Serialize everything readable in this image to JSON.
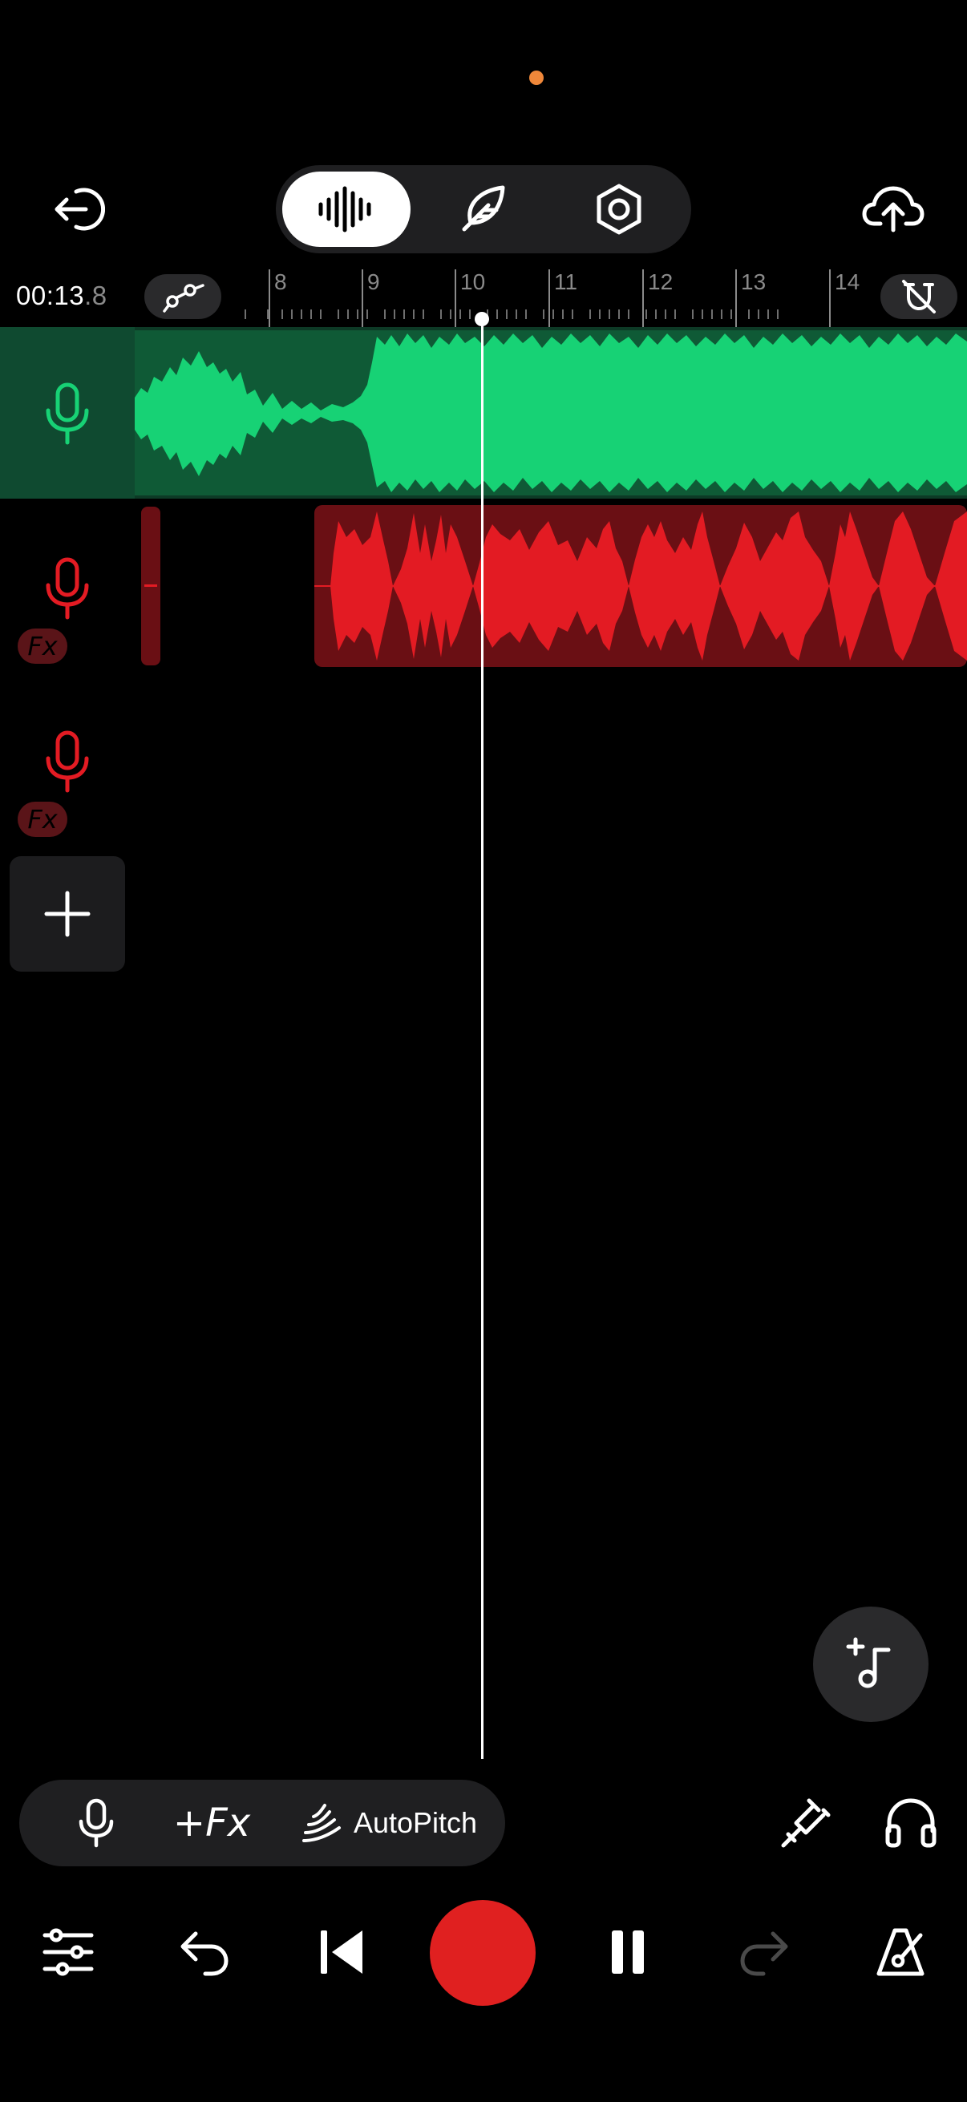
{
  "header": {
    "timecode_main": "00:13",
    "timecode_fraction": ".8",
    "modes": [
      "waveform-icon",
      "feather-icon",
      "hex-settings-icon"
    ],
    "active_mode": 0
  },
  "ruler": {
    "labels": [
      "8",
      "9",
      "10",
      "11",
      "12",
      "13",
      "14"
    ]
  },
  "tracks": [
    {
      "name": "track-1",
      "color": "#17d275",
      "fx": false
    },
    {
      "name": "track-2",
      "color": "#e31b23",
      "fx": true,
      "fx_label": "Fx"
    },
    {
      "name": "track-3",
      "color": "#e31b23",
      "fx": true,
      "fx_label": "Fx"
    }
  ],
  "toolbar": {
    "fx_label": "+Fx",
    "autopitch_label": "AutoPitch"
  },
  "colors": {
    "accent_green": "#17d275",
    "accent_red": "#e31b23",
    "record": "#e02020"
  }
}
